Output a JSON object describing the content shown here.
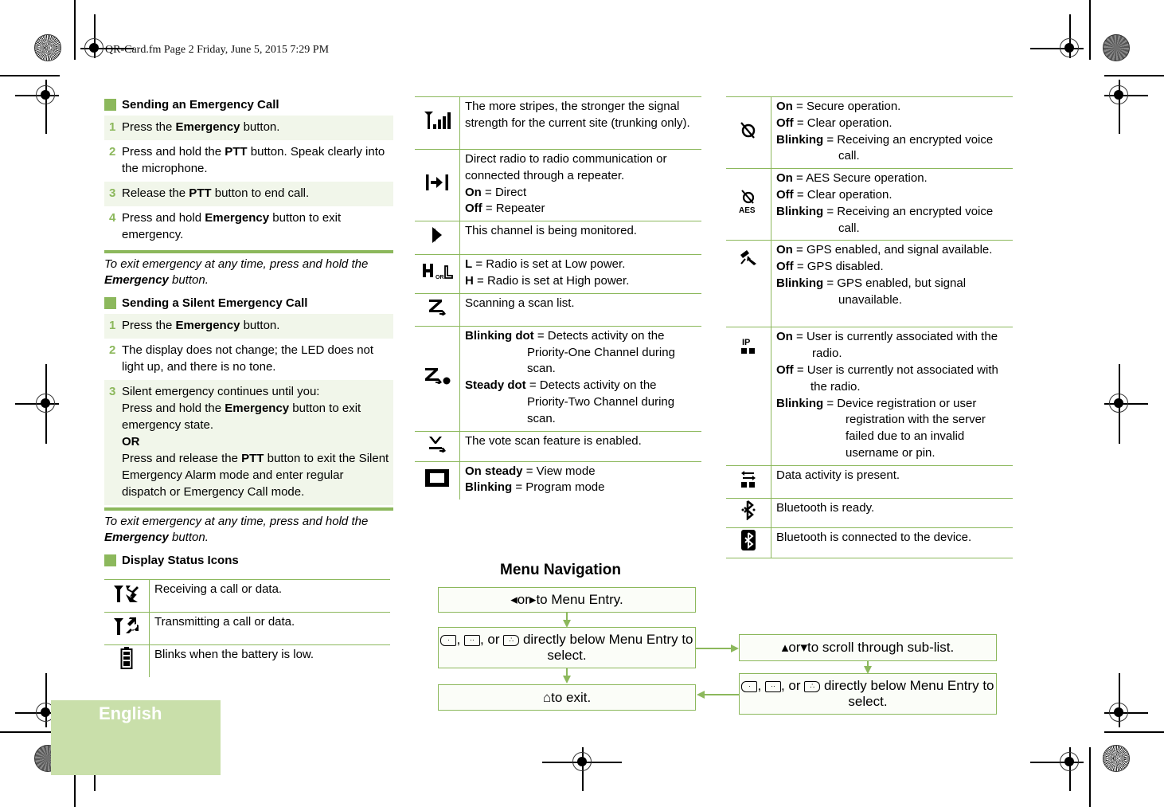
{
  "header": {
    "file_info": "QR-Card.fm  Page 2  Friday, June 5, 2015  7:29 PM"
  },
  "colors": {
    "accent": "#8cb85c",
    "shade": "#f1f6ea",
    "lang_tab": "#c9dfaa"
  },
  "emergency_call": {
    "title": "Sending an Emergency Call",
    "steps": [
      {
        "num": "1",
        "pre": "Press the ",
        "bold": "Emergency",
        "post": " button."
      },
      {
        "num": "2",
        "pre": "Press and hold the ",
        "bold": "PTT",
        "post": " button. Speak clearly into the microphone."
      },
      {
        "num": "3",
        "pre": "Release the ",
        "bold": "PTT",
        "post": " button to end call."
      },
      {
        "num": "4",
        "pre": "Press and hold ",
        "bold": "Emergency",
        "post": " button to exit emergency."
      }
    ],
    "note_pre": "To exit emergency at any time, press and hold the ",
    "note_bold": "Emergency",
    "note_post": " button."
  },
  "silent_call": {
    "title": "Sending a Silent Emergency Call",
    "steps": [
      {
        "num": "1",
        "pre": "Press the ",
        "bold": "Emergency",
        "post": " button."
      },
      {
        "num": "2",
        "text": "The display does not change; the LED does not light up, and there is no tone."
      },
      {
        "num": "3",
        "line1": "Silent emergency continues until you:",
        "l2pre": "Press and hold the ",
        "l2bold": "Emergency",
        "l2post": " button to exit emergency state.",
        "or": "OR",
        "l3pre": "Press and release the ",
        "l3bold": "PTT",
        "l3post": " button to exit the Silent Emergency Alarm mode and enter regular dispatch or Emergency Call mode."
      }
    ],
    "note_pre": "To exit emergency at any time, press and hold the ",
    "note_bold": "Emergency",
    "note_post": " button."
  },
  "status_icons": {
    "title": "Display Status Icons",
    "left": [
      {
        "icon": "receiving-icon",
        "text": "Receiving a call or data."
      },
      {
        "icon": "transmitting-icon",
        "text": "Transmitting a call or data."
      },
      {
        "icon": "battery-icon",
        "text": "Blinks when the battery is low."
      }
    ],
    "middle": {
      "signal": "The more stripes, the stronger the signal strength for the current site (trunking only).",
      "talkaround": {
        "text": "Direct radio to radio communication or connected through a repeater.",
        "on_k": "On",
        "on_v": " = Direct",
        "off_k": "Off",
        "off_v": " = Repeater"
      },
      "monitor": "This channel is being monitored.",
      "power": {
        "l_k": "L",
        "l_v": " = Radio is set at Low power.",
        "h_k": "H",
        "h_v": " = Radio is set at High power.",
        "icon_or": "OR"
      },
      "scan": "Scanning a scan list.",
      "priority_scan": {
        "blink_k": "Blinking dot",
        "blink_v": " = Detects activity on the Priority-One Channel during scan.",
        "steady_k": "Steady dot",
        "steady_v": " = Detects activity on the Priority-Two Channel during scan."
      },
      "vote_scan": "The vote scan feature is enabled.",
      "mode": {
        "on_k": "On steady",
        "on_v": " = View mode",
        "blink_k": "Blinking",
        "blink_v": " = Program mode"
      }
    },
    "right": {
      "secure": {
        "on_k": "On",
        "on_v": " = Secure operation.",
        "off_k": "Off",
        "off_v": " = Clear operation.",
        "blink_k": "Blinking",
        "blink_v": " = Receiving an encrypted voice call."
      },
      "aes": {
        "label": "AES",
        "on_k": "On",
        "on_v": " = AES Secure operation.",
        "off_k": "Off",
        "off_v": " = Clear operation.",
        "blink_k": "Blinking",
        "blink_v": " = Receiving an encrypted voice call."
      },
      "gps": {
        "on_k": "On",
        "on_v": " =  GPS enabled, and  signal available.",
        "off_k": "Off",
        "off_v": " =  GPS disabled.",
        "blink_k": "Blinking",
        "blink_v": " =  GPS enabled, but  signal unavailable."
      },
      "ip": {
        "label": "IP",
        "on_k": "On",
        "on_v": " = User is currently associated with the radio.",
        "off_k": "Off",
        "off_v": " = User is currently not associated with the radio.",
        "blink_k": "Blinking",
        "blink_v": " = Device registration or user registration with the server failed due to an invalid username or pin."
      },
      "data": "Data activity is present.",
      "bt_ready": "Bluetooth is ready.",
      "bt_connected": "Bluetooth is connected to the device."
    }
  },
  "menu_navigation": {
    "title": "Menu Navigation",
    "box1": {
      "left_sym": "◂",
      "or": " or ",
      "right_sym": "▸",
      "text": " to Menu Entry."
    },
    "box2": {
      "sep1": ", ",
      "sep2": ", or ",
      "text": " directly below Menu Entry to select."
    },
    "box3": {
      "sym": "⌂",
      "text": " to exit."
    },
    "box4": {
      "up_sym": "▴",
      "or": " or ",
      "down_sym": "▾",
      "text": " to scroll through sub-list."
    },
    "box5": {
      "sep1": ", ",
      "sep2": ", or ",
      "text": " directly below Menu Entry to select."
    }
  },
  "language_tab": "English"
}
